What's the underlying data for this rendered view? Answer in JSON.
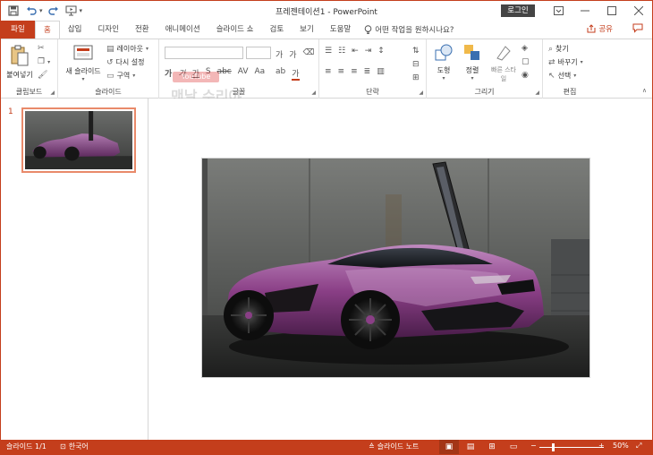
{
  "titlebar": {
    "title": "프레젠테이션1 - PowerPoint",
    "login": "로그인",
    "qat_touch_caret": "▾"
  },
  "tabs": [
    {
      "label": "파일"
    },
    {
      "label": "홈"
    },
    {
      "label": "삽입"
    },
    {
      "label": "디자인"
    },
    {
      "label": "전환"
    },
    {
      "label": "애니메이션"
    },
    {
      "label": "슬라이드 쇼"
    },
    {
      "label": "검토"
    },
    {
      "label": "보기"
    },
    {
      "label": "도움말"
    }
  ],
  "tellme": "어떤 작업을 원하시나요?",
  "share": "공유",
  "ribbon": {
    "clipboard": {
      "label": "클립보드",
      "paste": "붙여넣기"
    },
    "slides": {
      "label": "슬라이드",
      "new_slide": "새 슬라이드",
      "layout": "레이아웃",
      "reset": "다시 설정",
      "section": "구역"
    },
    "font": {
      "label": "글꼴",
      "font_name_hint": "가",
      "size_grow": "가",
      "size_shrink": "가"
    },
    "paragraph": {
      "label": "단락"
    },
    "drawing": {
      "label": "그리기",
      "shapes": "도형",
      "arrange": "정렬",
      "quick_styles": "빠른 스타일"
    },
    "editing": {
      "label": "편집",
      "find": "찾기",
      "replace": "바꾸기",
      "select": "선택"
    }
  },
  "watermark": {
    "youtube": "YouTube",
    "text": "맨날 수리야"
  },
  "thumbnails": [
    {
      "number": "1"
    }
  ],
  "statusbar": {
    "slide_count": "슬라이드 1/1",
    "language": "한국어",
    "notes": "슬라이드 노트",
    "zoom_minus": "−",
    "zoom_plus": "+",
    "zoom_level": "50%"
  },
  "colors": {
    "accent": "#c43e1c",
    "car_body": "#8a3f86",
    "wall": "#5c5e5c"
  }
}
